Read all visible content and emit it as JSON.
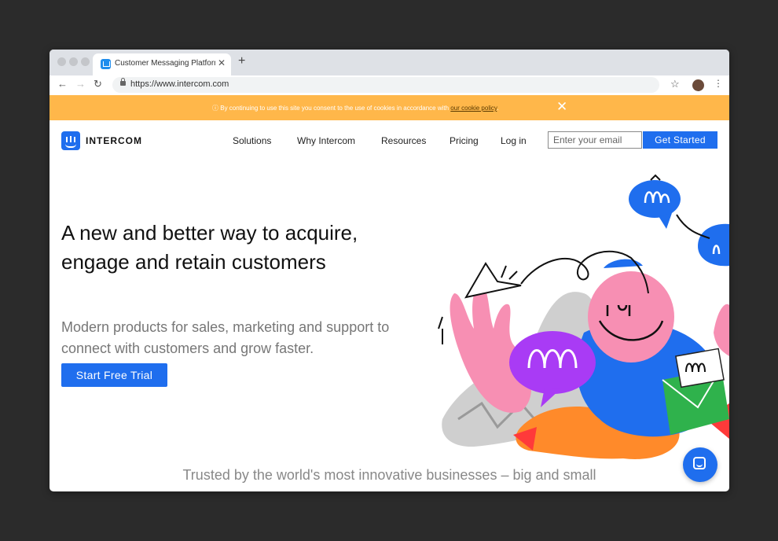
{
  "browser": {
    "tab_title": "Customer Messaging Platform",
    "tab_close": "✕",
    "new_tab": "+",
    "url": "https://www.intercom.com"
  },
  "cookie_banner": {
    "text": "By continuing to use this site you consent to the use of cookies in accordance with ",
    "link": "our cookie policy",
    "suffix": ".",
    "close": "✕"
  },
  "header": {
    "logo_text": "INTERCOM",
    "nav": [
      "Solutions",
      "Why Intercom",
      "Resources",
      "Pricing",
      "Log in"
    ],
    "email_placeholder": "Enter your email",
    "cta": "Get Started"
  },
  "hero": {
    "title": "A new and better way to acquire, engage and retain customers",
    "subtitle": "Modern products for sales, marketing and support to connect with customers and grow faster.",
    "cta": "Start Free Trial"
  },
  "trusted": "Trusted by the world's most innovative businesses – big and small",
  "colors": {
    "brand_blue": "#1f6eee",
    "cookie_orange": "#ffb74a",
    "pink": "#f78fb3",
    "purple": "#a93bf5",
    "green": "#2fb24c",
    "orange": "#ff8a2a"
  },
  "icons": [
    "lock-icon",
    "star-icon",
    "profile-icon",
    "menu-icon",
    "messenger-icon",
    "info-icon"
  ]
}
